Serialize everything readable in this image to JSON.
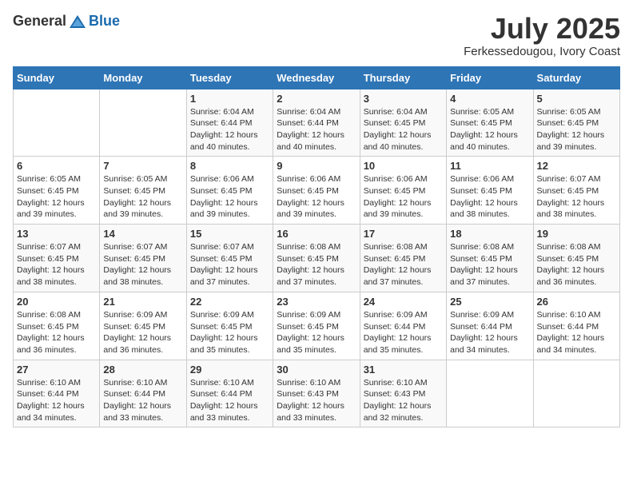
{
  "logo": {
    "general": "General",
    "blue": "Blue"
  },
  "title": {
    "month_year": "July 2025",
    "location": "Ferkessedougou, Ivory Coast"
  },
  "days_of_week": [
    "Sunday",
    "Monday",
    "Tuesday",
    "Wednesday",
    "Thursday",
    "Friday",
    "Saturday"
  ],
  "weeks": [
    [
      {
        "day": "",
        "info": ""
      },
      {
        "day": "",
        "info": ""
      },
      {
        "day": "1",
        "info": "Sunrise: 6:04 AM\nSunset: 6:44 PM\nDaylight: 12 hours and 40 minutes."
      },
      {
        "day": "2",
        "info": "Sunrise: 6:04 AM\nSunset: 6:44 PM\nDaylight: 12 hours and 40 minutes."
      },
      {
        "day": "3",
        "info": "Sunrise: 6:04 AM\nSunset: 6:45 PM\nDaylight: 12 hours and 40 minutes."
      },
      {
        "day": "4",
        "info": "Sunrise: 6:05 AM\nSunset: 6:45 PM\nDaylight: 12 hours and 40 minutes."
      },
      {
        "day": "5",
        "info": "Sunrise: 6:05 AM\nSunset: 6:45 PM\nDaylight: 12 hours and 39 minutes."
      }
    ],
    [
      {
        "day": "6",
        "info": "Sunrise: 6:05 AM\nSunset: 6:45 PM\nDaylight: 12 hours and 39 minutes."
      },
      {
        "day": "7",
        "info": "Sunrise: 6:05 AM\nSunset: 6:45 PM\nDaylight: 12 hours and 39 minutes."
      },
      {
        "day": "8",
        "info": "Sunrise: 6:06 AM\nSunset: 6:45 PM\nDaylight: 12 hours and 39 minutes."
      },
      {
        "day": "9",
        "info": "Sunrise: 6:06 AM\nSunset: 6:45 PM\nDaylight: 12 hours and 39 minutes."
      },
      {
        "day": "10",
        "info": "Sunrise: 6:06 AM\nSunset: 6:45 PM\nDaylight: 12 hours and 39 minutes."
      },
      {
        "day": "11",
        "info": "Sunrise: 6:06 AM\nSunset: 6:45 PM\nDaylight: 12 hours and 38 minutes."
      },
      {
        "day": "12",
        "info": "Sunrise: 6:07 AM\nSunset: 6:45 PM\nDaylight: 12 hours and 38 minutes."
      }
    ],
    [
      {
        "day": "13",
        "info": "Sunrise: 6:07 AM\nSunset: 6:45 PM\nDaylight: 12 hours and 38 minutes."
      },
      {
        "day": "14",
        "info": "Sunrise: 6:07 AM\nSunset: 6:45 PM\nDaylight: 12 hours and 38 minutes."
      },
      {
        "day": "15",
        "info": "Sunrise: 6:07 AM\nSunset: 6:45 PM\nDaylight: 12 hours and 37 minutes."
      },
      {
        "day": "16",
        "info": "Sunrise: 6:08 AM\nSunset: 6:45 PM\nDaylight: 12 hours and 37 minutes."
      },
      {
        "day": "17",
        "info": "Sunrise: 6:08 AM\nSunset: 6:45 PM\nDaylight: 12 hours and 37 minutes."
      },
      {
        "day": "18",
        "info": "Sunrise: 6:08 AM\nSunset: 6:45 PM\nDaylight: 12 hours and 37 minutes."
      },
      {
        "day": "19",
        "info": "Sunrise: 6:08 AM\nSunset: 6:45 PM\nDaylight: 12 hours and 36 minutes."
      }
    ],
    [
      {
        "day": "20",
        "info": "Sunrise: 6:08 AM\nSunset: 6:45 PM\nDaylight: 12 hours and 36 minutes."
      },
      {
        "day": "21",
        "info": "Sunrise: 6:09 AM\nSunset: 6:45 PM\nDaylight: 12 hours and 36 minutes."
      },
      {
        "day": "22",
        "info": "Sunrise: 6:09 AM\nSunset: 6:45 PM\nDaylight: 12 hours and 35 minutes."
      },
      {
        "day": "23",
        "info": "Sunrise: 6:09 AM\nSunset: 6:45 PM\nDaylight: 12 hours and 35 minutes."
      },
      {
        "day": "24",
        "info": "Sunrise: 6:09 AM\nSunset: 6:44 PM\nDaylight: 12 hours and 35 minutes."
      },
      {
        "day": "25",
        "info": "Sunrise: 6:09 AM\nSunset: 6:44 PM\nDaylight: 12 hours and 34 minutes."
      },
      {
        "day": "26",
        "info": "Sunrise: 6:10 AM\nSunset: 6:44 PM\nDaylight: 12 hours and 34 minutes."
      }
    ],
    [
      {
        "day": "27",
        "info": "Sunrise: 6:10 AM\nSunset: 6:44 PM\nDaylight: 12 hours and 34 minutes."
      },
      {
        "day": "28",
        "info": "Sunrise: 6:10 AM\nSunset: 6:44 PM\nDaylight: 12 hours and 33 minutes."
      },
      {
        "day": "29",
        "info": "Sunrise: 6:10 AM\nSunset: 6:44 PM\nDaylight: 12 hours and 33 minutes."
      },
      {
        "day": "30",
        "info": "Sunrise: 6:10 AM\nSunset: 6:43 PM\nDaylight: 12 hours and 33 minutes."
      },
      {
        "day": "31",
        "info": "Sunrise: 6:10 AM\nSunset: 6:43 PM\nDaylight: 12 hours and 32 minutes."
      },
      {
        "day": "",
        "info": ""
      },
      {
        "day": "",
        "info": ""
      }
    ]
  ]
}
